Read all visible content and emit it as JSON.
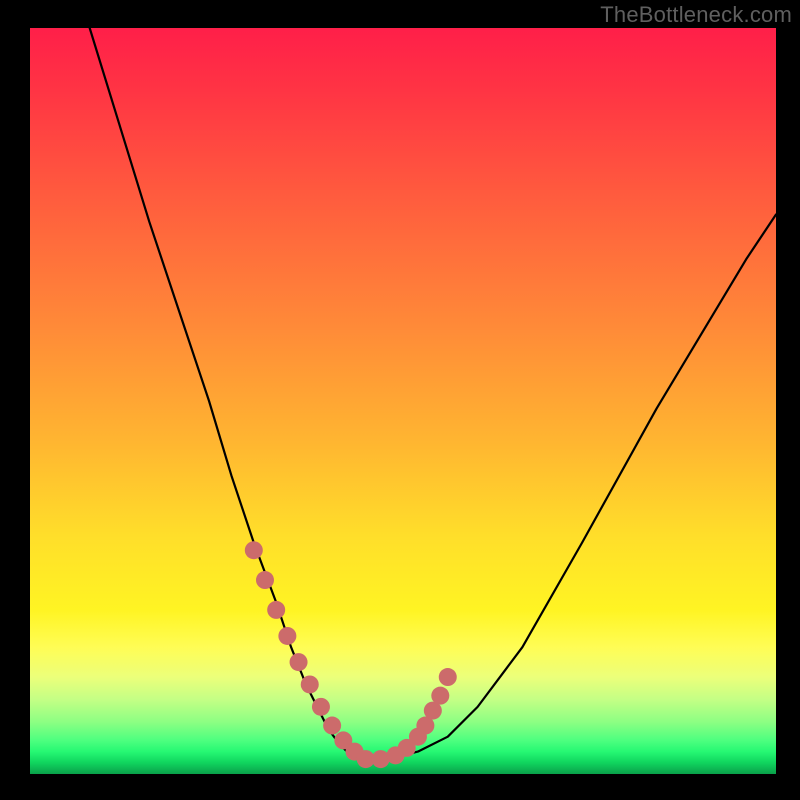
{
  "watermark": "TheBottleneck.com",
  "chart_data": {
    "type": "line",
    "title": "",
    "xlabel": "",
    "ylabel": "",
    "xlim": [
      0,
      100
    ],
    "ylim": [
      0,
      100
    ],
    "grid": false,
    "legend": false,
    "series": [
      {
        "name": "black-curve",
        "color": "#000000",
        "x": [
          8,
          12,
          16,
          20,
          24,
          27,
          30,
          33,
          35,
          37,
          38.5,
          40,
          41.5,
          43,
          45,
          48,
          52,
          56,
          60,
          66,
          74,
          84,
          96,
          100
        ],
        "y": [
          100,
          87,
          74,
          62,
          50,
          40,
          31,
          23,
          17,
          12,
          9,
          6,
          4,
          2.5,
          2,
          2,
          3,
          5,
          9,
          17,
          31,
          49,
          69,
          75
        ]
      },
      {
        "name": "red-dot-overlay",
        "color": "#cc6b6b",
        "marker": "circle",
        "x": [
          30,
          31.5,
          33,
          34.5,
          36,
          37.5,
          39,
          40.5,
          42,
          43.5,
          45,
          47,
          49,
          50.5,
          52,
          53,
          54,
          55,
          56
        ],
        "y": [
          30,
          26,
          22,
          18.5,
          15,
          12,
          9,
          6.5,
          4.5,
          3,
          2,
          2,
          2.5,
          3.5,
          5,
          6.5,
          8.5,
          10.5,
          13
        ]
      }
    ],
    "gradient_stops": [
      {
        "pos": 0.0,
        "color": "#ff1f49"
      },
      {
        "pos": 0.4,
        "color": "#ff8a38"
      },
      {
        "pos": 0.68,
        "color": "#ffde2a"
      },
      {
        "pos": 0.87,
        "color": "#ecff7a"
      },
      {
        "pos": 0.95,
        "color": "#4dff7f"
      },
      {
        "pos": 1.0,
        "color": "#0aa04a"
      }
    ]
  }
}
